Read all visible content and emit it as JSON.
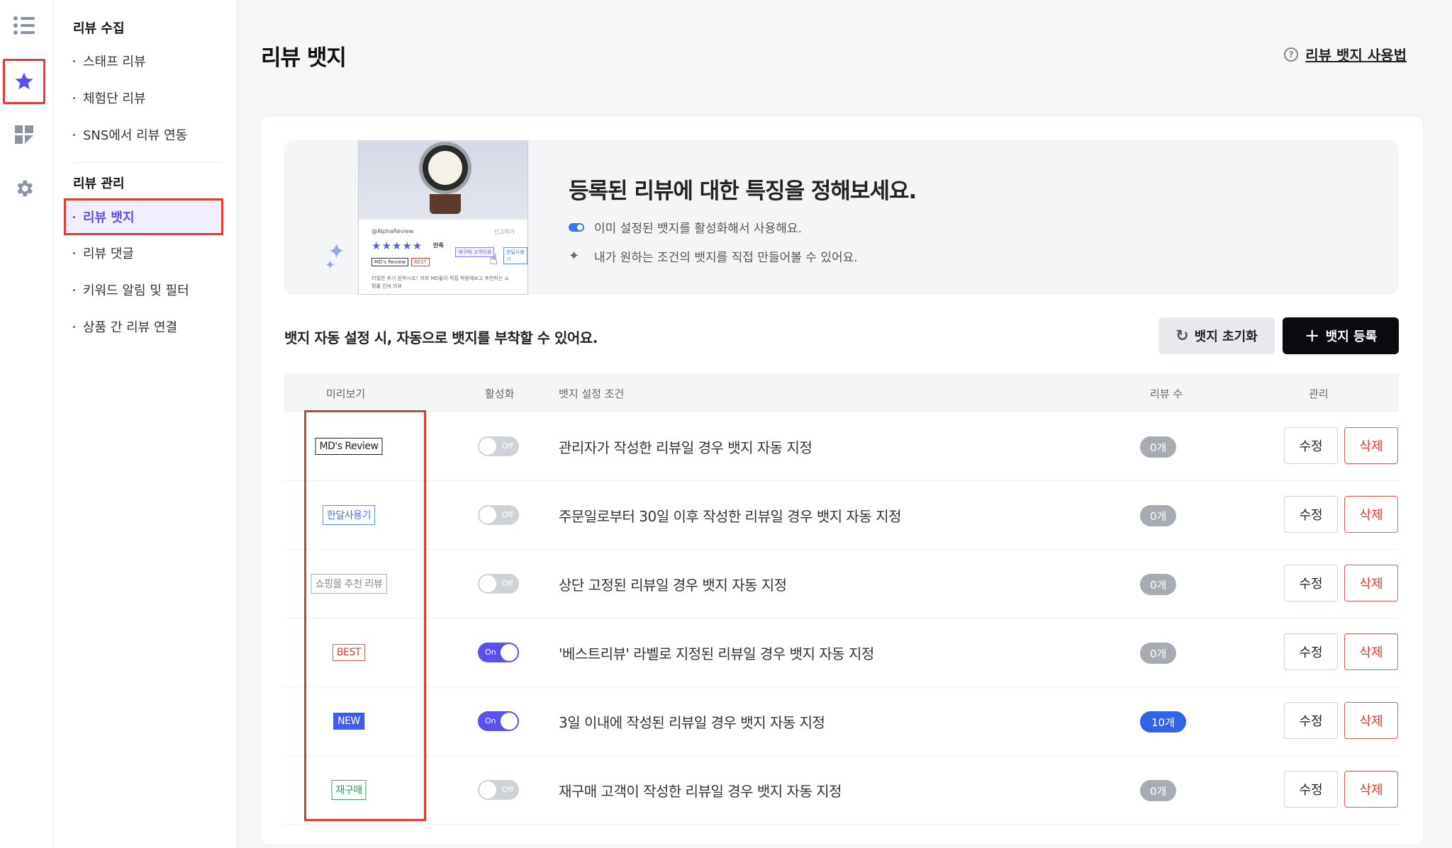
{
  "rail": {
    "items": [
      {
        "name": "list-icon"
      },
      {
        "name": "star-icon"
      },
      {
        "name": "dashboard-icon"
      },
      {
        "name": "gear-icon"
      }
    ],
    "active_color": "#5b51e9"
  },
  "subnav": {
    "section1": "리뷰 수집",
    "section1_items": [
      "스태프 리뷰",
      "체험단 리뷰",
      "SNS에서 리뷰 연동"
    ],
    "section2": "리뷰 관리",
    "section2_items": [
      "리뷰 뱃지",
      "리뷰 댓글",
      "키워드 알림 및 필터",
      "상품 간 리뷰 연결"
    ]
  },
  "header": {
    "title": "리뷰 뱃지",
    "help_icon": "?",
    "help_label": "리뷰 뱃지 사용법"
  },
  "banner": {
    "title": "등록된 리뷰에 대한 특징을 정해보세요.",
    "line1": "이미 설정된 뱃지를 활성화해서 사용해요.",
    "line2": "내가 원하는 조건의 뱃지를 직접 만들어볼 수 있어요.",
    "mock": {
      "user": "@AlphaReview",
      "date": "신고하기",
      "stars": "★★★★★",
      "satisfaction": "만족",
      "badge_md": "MD's Review",
      "badge_best": "BEST",
      "chip1": "재구매 고객리뷰",
      "chip2": "한달사용기",
      "text": "리얼한 후기 원하시죠? 저희 MD들이 직접 착용해보고 추천하는 쇼핑몰 인싸 리뷰"
    }
  },
  "toolbar": {
    "auto_text": "뱃지 자동 설정 시, 자동으로 뱃지를 부착할 수 있어요.",
    "reset_icon": "↻",
    "reset_label": "뱃지 초기화",
    "add_icon": "+",
    "add_label": "뱃지 등록"
  },
  "table": {
    "headers": {
      "preview": "미리보기",
      "active": "활성화",
      "condition": "뱃지 설정 조건",
      "count": "리뷰 수",
      "manage": "관리"
    },
    "edit_label": "수정",
    "delete_label": "삭제",
    "rows": [
      {
        "badge": "MD's Review",
        "toggle": "Off",
        "enabled": false,
        "condition": "관리자가 작성한 리뷰일 경우 뱃지 자동 지정",
        "count": "0개"
      },
      {
        "badge": "한달사용기",
        "toggle": "Off",
        "enabled": false,
        "condition": "주문일로부터 30일 이후 작성한 리뷰일 경우 뱃지 자동 지정",
        "count": "0개"
      },
      {
        "badge": "쇼핑몰 추천 리뷰",
        "toggle": "Off",
        "enabled": false,
        "condition": "상단 고정된 리뷰일 경우 뱃지 자동 지정",
        "count": "0개"
      },
      {
        "badge": "BEST",
        "toggle": "On",
        "enabled": true,
        "condition": "'베스트리뷰' 라벨로 지정된 리뷰일 경우 뱃지 자동 지정",
        "count": "0개"
      },
      {
        "badge": "NEW",
        "toggle": "On",
        "enabled": true,
        "condition": "3일 이내에 작성된 리뷰일 경우 뱃지 자동 지정",
        "count": "10개"
      },
      {
        "badge": "재구매",
        "toggle": "Off",
        "enabled": false,
        "condition": "재구매 고객이 작성한 리뷰일 경우 뱃지 자동 지정",
        "count": "0개"
      }
    ]
  },
  "colors": {
    "accent": "#5b4ff0",
    "highlight": "#e53935",
    "count_active": "#2f64e8"
  }
}
